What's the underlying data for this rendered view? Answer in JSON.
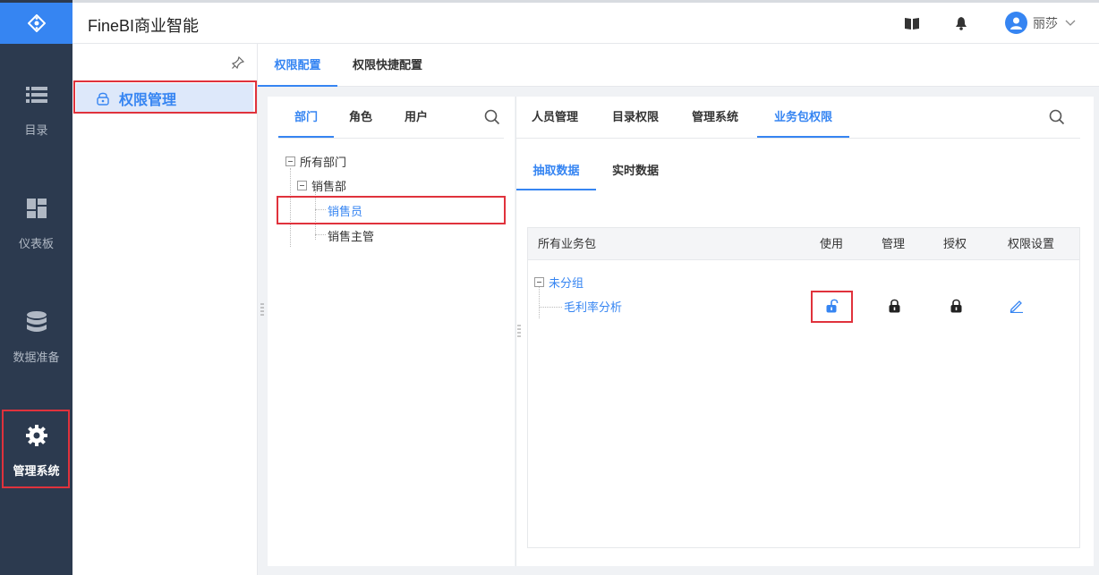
{
  "app": {
    "title": "FineBI商业智能"
  },
  "nav": {
    "items": [
      {
        "label": "目录",
        "icon": "list-icon"
      },
      {
        "label": "仪表板",
        "icon": "dashboard-icon"
      },
      {
        "label": "数据准备",
        "icon": "database-icon"
      },
      {
        "label": "管理系统",
        "icon": "gear-icon"
      }
    ]
  },
  "header": {
    "user_name": "丽莎"
  },
  "subnav": {
    "active_item": "权限管理"
  },
  "main": {
    "tabs": [
      "权限配置",
      "权限快捷配置"
    ],
    "left_tabs": [
      "部门",
      "角色",
      "用户"
    ],
    "tree": {
      "root": "所有部门",
      "dept": "销售部",
      "role_selected": "销售员",
      "role_other": "销售主管"
    },
    "right_tabs": [
      "人员管理",
      "目录权限",
      "管理系统",
      "业务包权限"
    ],
    "data_tabs": [
      "抽取数据",
      "实时数据"
    ],
    "table": {
      "columns": [
        "所有业务包",
        "使用",
        "管理",
        "授权",
        "权限设置"
      ],
      "group": "未分组",
      "package": "毛利率分析"
    }
  },
  "colors": {
    "accent": "#3685f2",
    "nav_bg": "#2c3a4f",
    "highlight_border": "#e0323c"
  }
}
